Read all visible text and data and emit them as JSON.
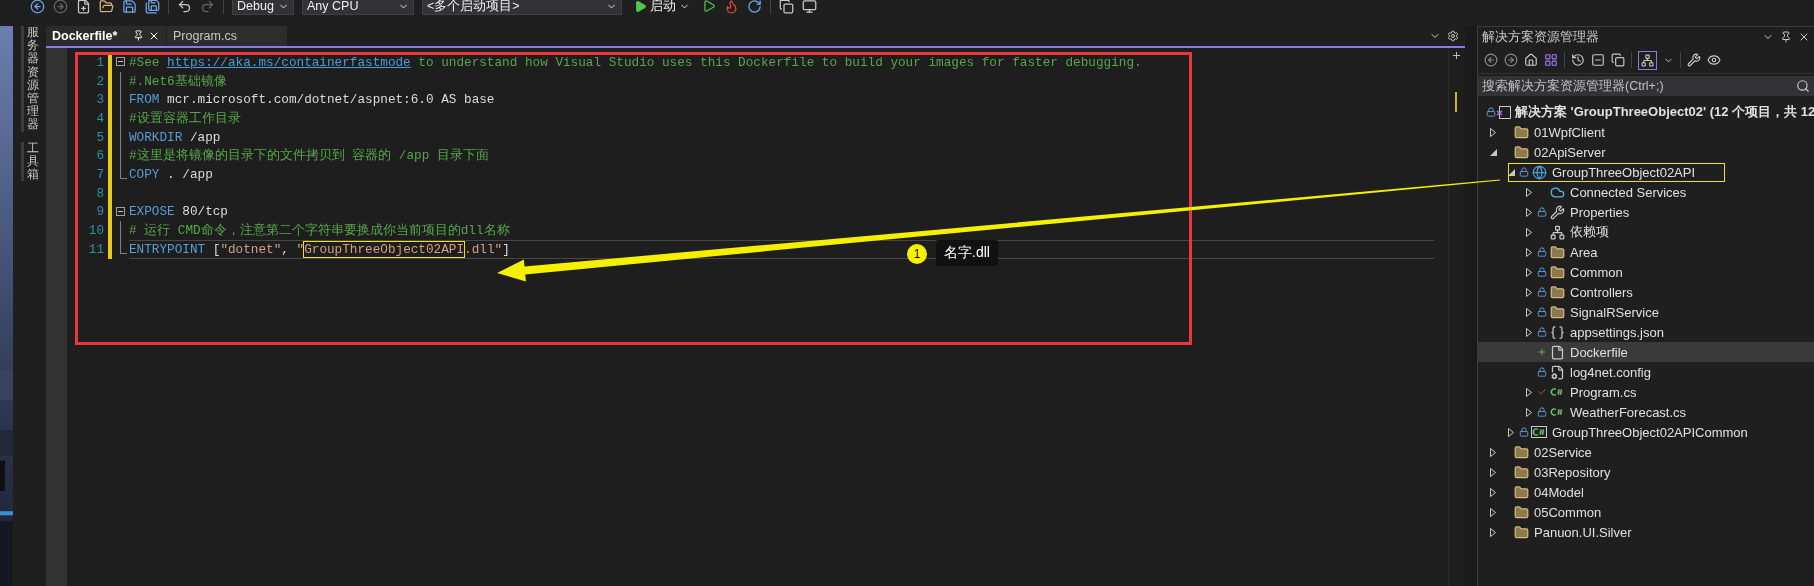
{
  "toolbar": {
    "configuration": "Debug",
    "platform": "Any CPU",
    "startup_project": "<多个启动项目>",
    "start_button": "启动"
  },
  "side_tabs": [
    "服务器资源管理器",
    "工具箱"
  ],
  "editor": {
    "tabs": [
      {
        "label": "Dockerfile*",
        "selected": true
      },
      {
        "label": "Program.cs",
        "selected": false
      }
    ],
    "blocks": [
      {
        "collapsible": true,
        "lines": [
          {
            "number": "1",
            "changed": true,
            "current": false,
            "tokens": [
              {
                "kind": "comment",
                "text": "#See "
              },
              {
                "kind": "link",
                "text": "https://aka.ms/containerfastmode"
              },
              {
                "kind": "comment",
                "text": " to understand how Visual Studio uses this Dockerfile to build your images for faster debugging."
              }
            ]
          },
          {
            "number": "2",
            "changed": true,
            "current": false,
            "tokens": [
              {
                "kind": "comment",
                "text": "#.Net6基础镜像"
              }
            ]
          },
          {
            "number": "3",
            "changed": true,
            "current": false,
            "tokens": [
              {
                "kind": "keyword",
                "text": "FROM"
              },
              {
                "kind": "text",
                "text": " mcr.microsoft.com/dotnet/aspnet:6.0 AS base"
              }
            ]
          },
          {
            "number": "4",
            "changed": true,
            "current": false,
            "tokens": [
              {
                "kind": "comment",
                "text": "#设置容器工作目录"
              }
            ]
          },
          {
            "number": "5",
            "changed": true,
            "current": false,
            "tokens": [
              {
                "kind": "keyword",
                "text": "WORKDIR"
              },
              {
                "kind": "text",
                "text": " /app"
              }
            ]
          },
          {
            "number": "6",
            "changed": true,
            "current": false,
            "tokens": [
              {
                "kind": "comment",
                "text": "#这里是将镜像的目录下的文件拷贝到 容器的 /app 目录下面"
              }
            ]
          },
          {
            "number": "7",
            "changed": true,
            "current": false,
            "tokens": [
              {
                "kind": "keyword",
                "text": "COPY"
              },
              {
                "kind": "text",
                "text": " . /app"
              }
            ]
          }
        ]
      },
      {
        "collapsible": false,
        "lines": [
          {
            "number": "8",
            "changed": true,
            "current": false
          }
        ]
      },
      {
        "collapsible": true,
        "lines": [
          {
            "number": "9",
            "changed": true,
            "current": false,
            "tokens": [
              {
                "kind": "keyword",
                "text": "EXPOSE"
              },
              {
                "kind": "text",
                "text": " 80/tcp"
              }
            ]
          },
          {
            "number": "10",
            "changed": true,
            "current": false,
            "tokens": [
              {
                "kind": "comment",
                "text": "# 运行 CMD命令，注意第二个字符串要换成你当前项目的dll名称"
              }
            ]
          },
          {
            "number": "11",
            "changed": true,
            "current": true,
            "tokens": [
              {
                "kind": "keyword",
                "text": "ENTRYPOINT"
              },
              {
                "kind": "text",
                "text": " ["
              },
              {
                "kind": "string",
                "text": "\"dotnet\""
              },
              {
                "kind": "text",
                "text": ", "
              },
              {
                "kind": "string",
                "text": "\""
              },
              {
                "kind": "string",
                "text": "GroupThreeObject02API",
                "boxed": true
              },
              {
                "kind": "string",
                "text": ".dll\""
              },
              {
                "kind": "text",
                "text": "]"
              }
            ]
          }
        ]
      }
    ],
    "annotation": {
      "badge": "1",
      "label": "名字.dll"
    }
  },
  "solution_explorer": {
    "title": "解决方案资源管理器",
    "search_placeholder": "搜索解决方案资源管理器(Ctrl+;)",
    "root": {
      "label": "解决方案 'GroupThreeObject02' (12 个项目，共 12",
      "locked": true
    },
    "tree": [
      {
        "label": "01WpfClient",
        "kind": "folder",
        "locked": false,
        "added": false,
        "checked": false,
        "expanded": false,
        "selected": false
      },
      {
        "label": "02ApiServer",
        "kind": "folder",
        "locked": false,
        "added": false,
        "checked": false,
        "expanded": true,
        "selected": false,
        "children": [
          {
            "label": "GroupThreeObject02API",
            "kind": "project",
            "locked": true,
            "added": false,
            "checked": false,
            "expanded": true,
            "selected": false,
            "boxed": true,
            "children": [
              {
                "label": "Connected Services",
                "kind": "service",
                "locked": false,
                "added": false,
                "checked": false,
                "expanded": false,
                "selected": false
              },
              {
                "label": "Properties",
                "kind": "properties",
                "locked": true,
                "added": false,
                "checked": false,
                "expanded": false,
                "selected": false
              },
              {
                "label": "依赖项",
                "kind": "dependencies",
                "locked": false,
                "added": false,
                "checked": false,
                "expanded": false,
                "selected": false
              },
              {
                "label": "Area",
                "kind": "folder",
                "locked": true,
                "added": false,
                "checked": false,
                "expanded": false,
                "selected": false
              },
              {
                "label": "Common",
                "kind": "folder",
                "locked": true,
                "added": false,
                "checked": false,
                "expanded": false,
                "selected": false
              },
              {
                "label": "Controllers",
                "kind": "folder",
                "locked": true,
                "added": false,
                "checked": false,
                "expanded": false,
                "selected": false
              },
              {
                "label": "SignalRService",
                "kind": "folder",
                "locked": true,
                "added": false,
                "checked": false,
                "expanded": false,
                "selected": false
              },
              {
                "label": "appsettings.json",
                "kind": "settings",
                "locked": true,
                "added": false,
                "checked": false,
                "expanded": false,
                "selected": false
              },
              {
                "label": "Dockerfile",
                "kind": "file",
                "locked": false,
                "added": true,
                "checked": false,
                "selected": true
              },
              {
                "label": "log4net.config",
                "kind": "config",
                "locked": true,
                "added": false,
                "checked": false,
                "selected": false
              },
              {
                "label": "Program.cs",
                "kind": "code",
                "locked": false,
                "added": false,
                "checked": true,
                "expanded": false,
                "selected": false
              },
              {
                "label": "WeatherForecast.cs",
                "kind": "code",
                "locked": true,
                "added": false,
                "checked": false,
                "expanded": false,
                "selected": false
              }
            ]
          },
          {
            "label": "GroupThreeObject02APICommon",
            "kind": "library",
            "locked": true,
            "added": false,
            "checked": false,
            "expanded": false,
            "selected": false
          }
        ]
      },
      {
        "label": "02Service",
        "kind": "folder",
        "locked": false,
        "added": false,
        "checked": false,
        "expanded": false,
        "selected": false
      },
      {
        "label": "03Repository",
        "kind": "folder",
        "locked": false,
        "added": false,
        "checked": false,
        "expanded": false,
        "selected": false
      },
      {
        "label": "04Model",
        "kind": "folder",
        "locked": false,
        "added": false,
        "checked": false,
        "expanded": false,
        "selected": false
      },
      {
        "label": "05Common",
        "kind": "folder",
        "locked": false,
        "added": false,
        "checked": false,
        "expanded": false,
        "selected": false
      },
      {
        "label": "Panuon.UI.Silver",
        "kind": "folder",
        "locked": false,
        "added": false,
        "checked": false,
        "expanded": false,
        "selected": false
      }
    ]
  }
}
